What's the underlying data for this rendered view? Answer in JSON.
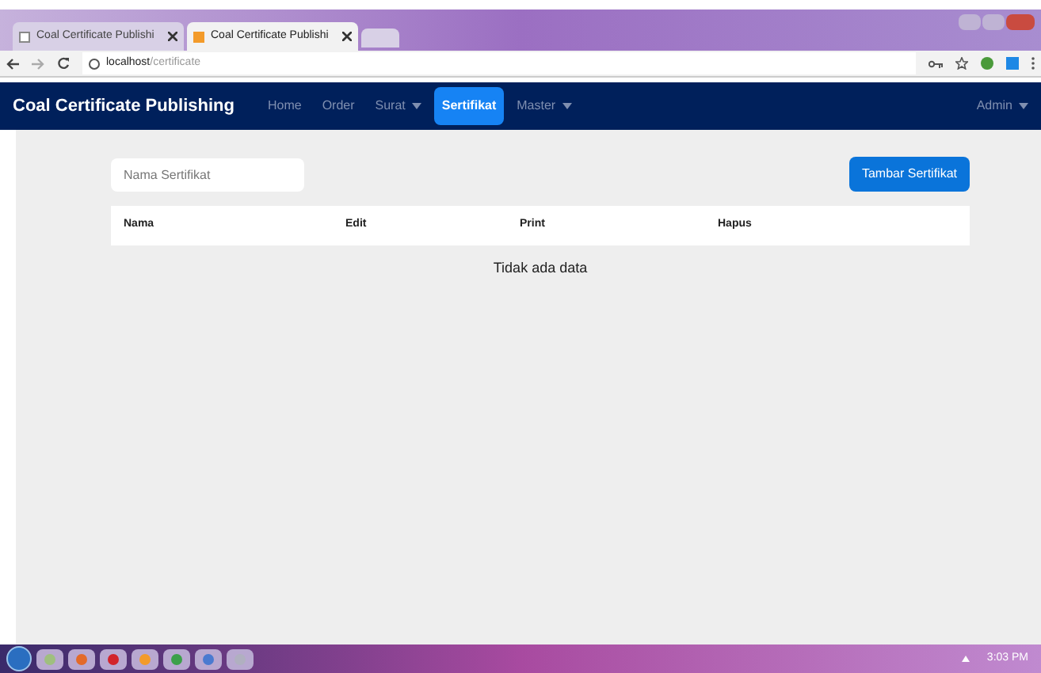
{
  "browser": {
    "tabs": [
      {
        "title": "Coal Certificate Publishi",
        "selected": false
      },
      {
        "title": "Coal Certificate Publishi",
        "selected": true
      }
    ],
    "address": {
      "host": "localhost",
      "path": "/certificate"
    }
  },
  "navbar": {
    "brand": "Coal Certificate Publishing",
    "items": [
      {
        "label": "Home",
        "selected": false,
        "dropdown": false
      },
      {
        "label": "Order",
        "selected": false,
        "dropdown": false
      },
      {
        "label": "Surat",
        "selected": false,
        "dropdown": true
      },
      {
        "label": "Sertifikat",
        "selected": true,
        "dropdown": false
      },
      {
        "label": "Master",
        "selected": false,
        "dropdown": true
      }
    ],
    "user": "Admin"
  },
  "search": {
    "placeholder": "Nama Sertifikat"
  },
  "add_button": "Tambar Sertifikat",
  "table": {
    "columns": [
      "Nama",
      "Edit",
      "Print",
      "Hapus"
    ],
    "empty_message": "Tidak ada data"
  },
  "taskbar": {
    "clock": "3:03 PM"
  }
}
